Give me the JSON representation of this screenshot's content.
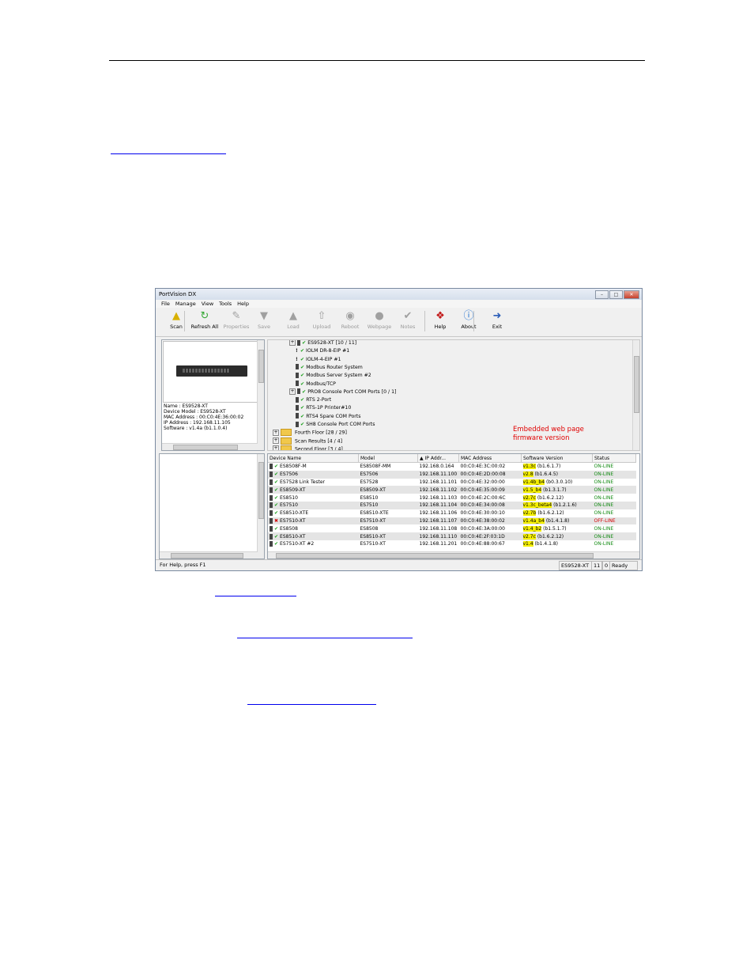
{
  "window": {
    "title": "PortVision DX",
    "menu": [
      "File",
      "Manage",
      "View",
      "Tools",
      "Help"
    ],
    "toolbar": [
      {
        "label": "Scan",
        "icon": "scan-icon",
        "enabled": true
      },
      {
        "label": "Refresh All",
        "icon": "refresh-icon",
        "enabled": true
      },
      {
        "label": "Properties",
        "icon": "properties-icon",
        "enabled": false
      },
      {
        "label": "Save",
        "icon": "save-icon",
        "enabled": false
      },
      {
        "label": "Load",
        "icon": "load-icon",
        "enabled": false
      },
      {
        "label": "Upload",
        "icon": "upload-icon",
        "enabled": false
      },
      {
        "label": "Reboot",
        "icon": "reboot-icon",
        "enabled": false
      },
      {
        "label": "Webpage",
        "icon": "webpage-icon",
        "enabled": false
      },
      {
        "label": "Notes",
        "icon": "notes-icon",
        "enabled": false
      },
      {
        "label": "Help",
        "icon": "help-icon",
        "enabled": true
      },
      {
        "label": "About",
        "icon": "about-icon",
        "enabled": true
      },
      {
        "label": "Exit",
        "icon": "exit-icon",
        "enabled": true
      }
    ]
  },
  "device_info": {
    "name": "Name : ES9528-XT",
    "model": "Device Model : ES9528-XT",
    "mac": "MAC Address : 00:C0:4E:36:00:02",
    "ip": "IP Address : 192.168.11.105",
    "software": "Software : v1.4a  (b1.1.0.4)"
  },
  "tree": [
    {
      "label": "ES9528-XT [10 / 11]",
      "type": "device",
      "expand": true
    },
    {
      "label": "IOLM DR-8-EIP #1",
      "type": "warn"
    },
    {
      "label": "IOLM-4-EIP #1",
      "type": "warn"
    },
    {
      "label": "Modbus Router System",
      "type": "device"
    },
    {
      "label": "Modbus Server System #2",
      "type": "device"
    },
    {
      "label": "Modbus/TCP",
      "type": "device"
    },
    {
      "label": "PRO8 Console Port COM Ports [0 / 1]",
      "type": "device",
      "expand": true
    },
    {
      "label": "RTS 2-Port",
      "type": "device"
    },
    {
      "label": "RTS-1P Printer#10",
      "type": "device"
    },
    {
      "label": "RTS4 Spare COM Ports",
      "type": "device"
    },
    {
      "label": "SH8 Console Port COM Ports",
      "type": "device"
    },
    {
      "label": "Fourth Floor [28 / 29]",
      "type": "folder"
    },
    {
      "label": "Scan Results [4 / 4]",
      "type": "folder"
    },
    {
      "label": "Second Floor [3 / 4]",
      "type": "folder"
    }
  ],
  "annotation": {
    "line1": "Embedded web page",
    "line2": "firmware version"
  },
  "columns": [
    "Device Name",
    "Model",
    "IP Addr...",
    "MAC Address",
    "Software Version",
    "Status"
  ],
  "rows": [
    {
      "name": "ES8508F-M",
      "model": "ES8508F-MM",
      "ip": "192.168.0.164",
      "mac": "00:C0:4E:3C:00:02",
      "ver": "v1.3c",
      "build": "(b1.6.1.7)",
      "status": "ON-LINE",
      "ok": true
    },
    {
      "name": "ES7506",
      "model": "ES7506",
      "ip": "192.168.11.100",
      "mac": "00:C0:4E:2D:00:08",
      "ver": "v2.8",
      "build": "(b1.6.4.5)",
      "status": "ON-LINE",
      "ok": true
    },
    {
      "name": "ES7528 Link Tester",
      "model": "ES7528",
      "ip": "192.168.11.101",
      "mac": "00:C0:4E:32:00:00",
      "ver": "v1.4b_b4",
      "build": "(b0.3.0.10)",
      "status": "ON-LINE",
      "ok": true
    },
    {
      "name": "ES8509-XT",
      "model": "ES8509-XT",
      "ip": "192.168.11.102",
      "mac": "00:C0:4E:35:00:09",
      "ver": "v1.5_b4",
      "build": "(b1.3.1.7)",
      "status": "ON-LINE",
      "ok": true
    },
    {
      "name": "ES8510",
      "model": "ES8510",
      "ip": "192.168.11.103",
      "mac": "00:C0:4E:2C:00:6C",
      "ver": "v2.7c",
      "build": "(b1.6.2.12)",
      "status": "ON-LINE",
      "ok": true
    },
    {
      "name": "ES7510",
      "model": "ES7510",
      "ip": "192.168.11.104",
      "mac": "00:C0:4E:34:00:08",
      "ver": "v1.3c_beta4",
      "build": "(b1.2.1.6)",
      "status": "ON-LINE",
      "ok": true
    },
    {
      "name": "ES8510-XTE",
      "model": "ES8510-XTE",
      "ip": "192.168.11.106",
      "mac": "00:C0:4E:30:00:10",
      "ver": "v2.7b",
      "build": "(b1.6.2.12)",
      "status": "ON-LINE",
      "ok": true
    },
    {
      "name": "ES7510-XT",
      "model": "ES7510-XT",
      "ip": "192.168.11.107",
      "mac": "00:C0:4E:38:00:02",
      "ver": "v1.4a_b4",
      "build": "(b1.4.1.8)",
      "status": "OFF-LINE",
      "ok": false
    },
    {
      "name": "ES8508",
      "model": "ES8508",
      "ip": "192.168.11.108",
      "mac": "00:C0:4E:3A:00:00",
      "ver": "v1.4_b2",
      "build": "(b1.5.1.7)",
      "status": "ON-LINE",
      "ok": true
    },
    {
      "name": "ES8510-XT",
      "model": "ES8510-XT",
      "ip": "192.168.11.110",
      "mac": "00:C0:4E:2F:03:1D",
      "ver": "v2.7c",
      "build": "(b1.6.2.12)",
      "status": "ON-LINE",
      "ok": true
    },
    {
      "name": "ES7510-XT #2",
      "model": "ES7510-XT",
      "ip": "192.168.11.201",
      "mac": "00:C0:4E:88:00:67",
      "ver": "v1.4",
      "build": "(b1.4.1.8)",
      "status": "ON-LINE",
      "ok": true
    }
  ],
  "statusbar": {
    "help": "For Help, press F1",
    "device": "ES9528-XT",
    "count": "11",
    "zero": "0",
    "state": "Ready"
  }
}
